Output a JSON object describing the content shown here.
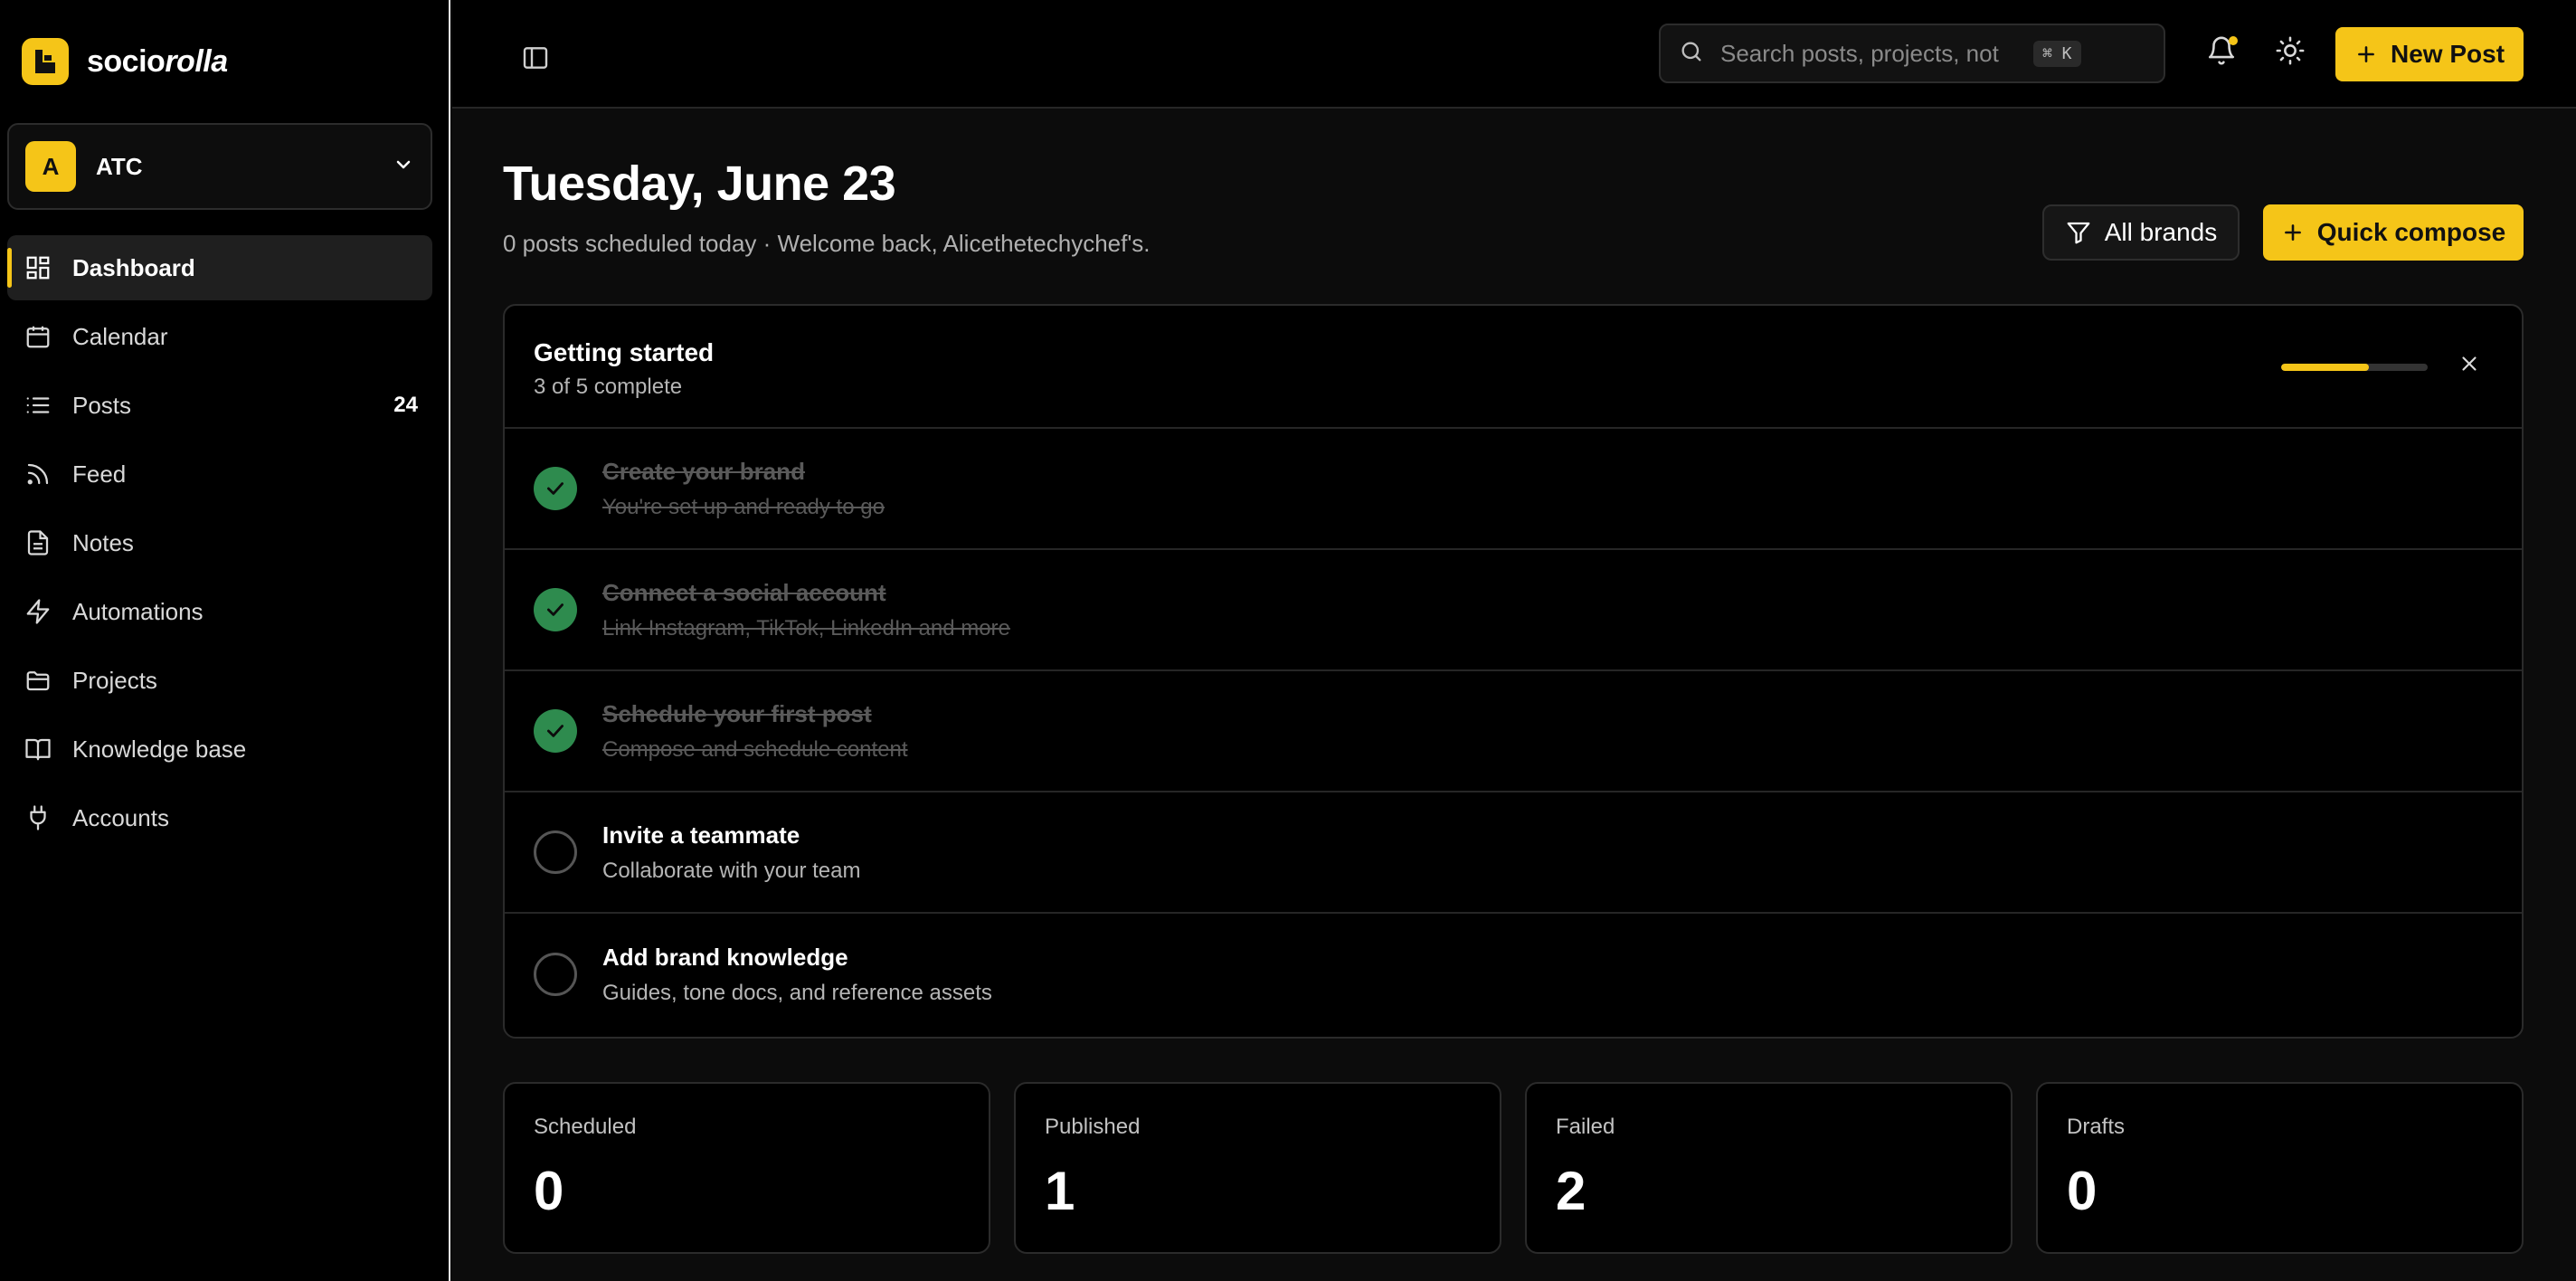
{
  "app": {
    "logo_part1": "socio",
    "logo_part2": "rolla"
  },
  "brand_switcher": {
    "avatar_letter": "A",
    "name": "ATC"
  },
  "sidebar": {
    "items": [
      {
        "label": "Dashboard",
        "icon": "dashboard-icon",
        "active": true,
        "count": ""
      },
      {
        "label": "Calendar",
        "icon": "calendar-icon",
        "count": ""
      },
      {
        "label": "Posts",
        "icon": "list-icon",
        "count": "24"
      },
      {
        "label": "Feed",
        "icon": "rss-icon",
        "count": ""
      },
      {
        "label": "Notes",
        "icon": "note-icon",
        "count": ""
      },
      {
        "label": "Automations",
        "icon": "bolt-icon",
        "count": ""
      },
      {
        "label": "Projects",
        "icon": "folder-icon",
        "count": ""
      },
      {
        "label": "Knowledge base",
        "icon": "book-icon",
        "count": ""
      },
      {
        "label": "Accounts",
        "icon": "plug-icon",
        "count": ""
      }
    ]
  },
  "topbar": {
    "search_placeholder": "Search posts, projects, not",
    "search_shortcut": "⌘ K",
    "new_post_label": "New Post"
  },
  "header": {
    "title": "Tuesday, June 23",
    "subtitle": "0 posts scheduled today · Welcome back, Alicethetechychef's.",
    "filter_label": "All brands",
    "quick_compose_label": "Quick compose"
  },
  "getting_started": {
    "title": "Getting started",
    "progress_text": "3 of 5 complete",
    "progress_fraction": 0.6,
    "tasks": [
      {
        "title": "Create your brand",
        "desc": "You're set up and ready to go",
        "done": true
      },
      {
        "title": "Connect a social account",
        "desc": "Link Instagram, TikTok, LinkedIn and more",
        "done": true
      },
      {
        "title": "Schedule your first post",
        "desc": "Compose and schedule content",
        "done": true
      },
      {
        "title": "Invite a teammate",
        "desc": "Collaborate with your team",
        "done": false
      },
      {
        "title": "Add brand knowledge",
        "desc": "Guides, tone docs, and reference assets",
        "done": false
      }
    ]
  },
  "stats": [
    {
      "label": "Scheduled",
      "value": "0"
    },
    {
      "label": "Published",
      "value": "1"
    },
    {
      "label": "Failed",
      "value": "2"
    },
    {
      "label": "Drafts",
      "value": "0"
    }
  ],
  "colors": {
    "accent": "#f5c518",
    "success": "#2e8b4e",
    "background": "#0c0c0c"
  }
}
